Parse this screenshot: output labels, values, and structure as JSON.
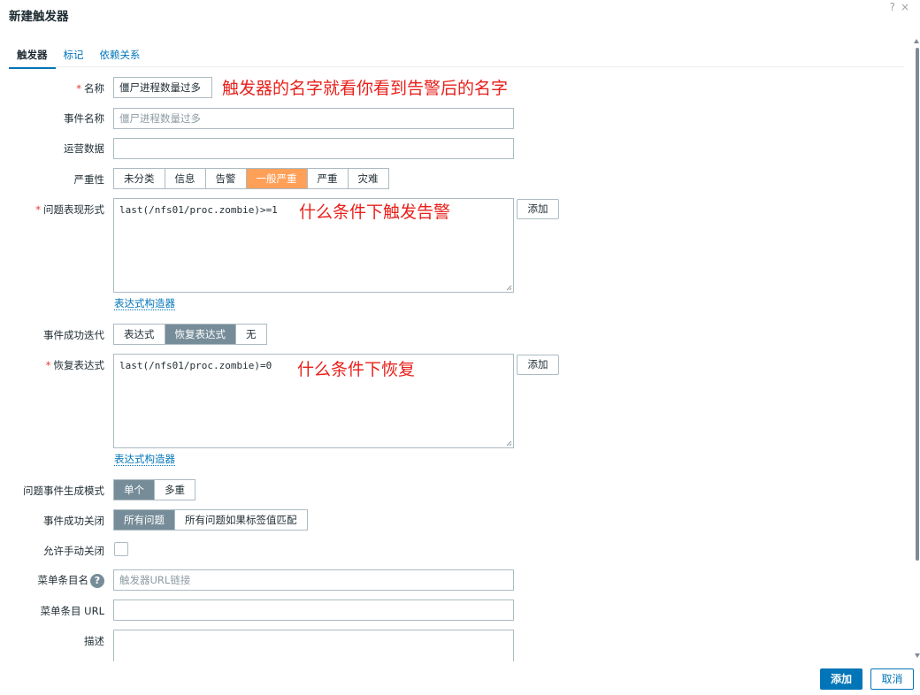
{
  "dialog": {
    "title": "新建触发器",
    "help_icon": "?",
    "close_icon": "×"
  },
  "tabs": [
    {
      "label": "触发器",
      "active": true
    },
    {
      "label": "标记",
      "active": false
    },
    {
      "label": "依赖关系",
      "active": false
    }
  ],
  "form": {
    "name": {
      "label": "名称",
      "required": true,
      "value": "僵尸进程数量过多"
    },
    "event_name": {
      "label": "事件名称",
      "placeholder": "僵尸进程数量过多"
    },
    "operational_data": {
      "label": "运营数据",
      "value": ""
    },
    "severity": {
      "label": "严重性",
      "options": [
        "未分类",
        "信息",
        "告警",
        "一般严重",
        "严重",
        "灾难"
      ],
      "selected": "一般严重"
    },
    "problem_expression": {
      "label": "问题表现形式",
      "required": true,
      "value": "last(/nfs01/proc.zombie)>=1",
      "add_button": "添加",
      "builder_link": "表达式构造器"
    },
    "ok_event_generation": {
      "label": "事件成功迭代",
      "options": [
        "表达式",
        "恢复表达式",
        "无"
      ],
      "selected": "恢复表达式"
    },
    "recovery_expression": {
      "label": "恢复表达式",
      "required": true,
      "value": "last(/nfs01/proc.zombie)=0",
      "add_button": "添加",
      "builder_link": "表达式构造器"
    },
    "problem_event_mode": {
      "label": "问题事件生成模式",
      "options": [
        "单个",
        "多重"
      ],
      "selected": "单个"
    },
    "ok_event_closes": {
      "label": "事件成功关闭",
      "options": [
        "所有问题",
        "所有问题如果标签值匹配"
      ],
      "selected": "所有问题"
    },
    "allow_manual_close": {
      "label": "允许手动关闭",
      "checked": false
    },
    "menu_entry_name": {
      "label": "菜单条目名",
      "help": "?",
      "placeholder": "触发器URL链接"
    },
    "menu_entry_url": {
      "label": "菜单条目 URL",
      "value": ""
    },
    "description": {
      "label": "描述",
      "value": ""
    }
  },
  "annotations": {
    "name_note": "触发器的名字就看你看到告警后的名字",
    "problem_note": "什么条件下触发告警",
    "recovery_note": "什么条件下恢复"
  },
  "footer": {
    "add_button": "添加",
    "cancel_button": "取消"
  },
  "colors": {
    "accent": "#0275b8",
    "severity_selected": "#ffa059",
    "toggle_selected": "#768d99",
    "annotation": "#e8201b",
    "required": "#e33734"
  }
}
